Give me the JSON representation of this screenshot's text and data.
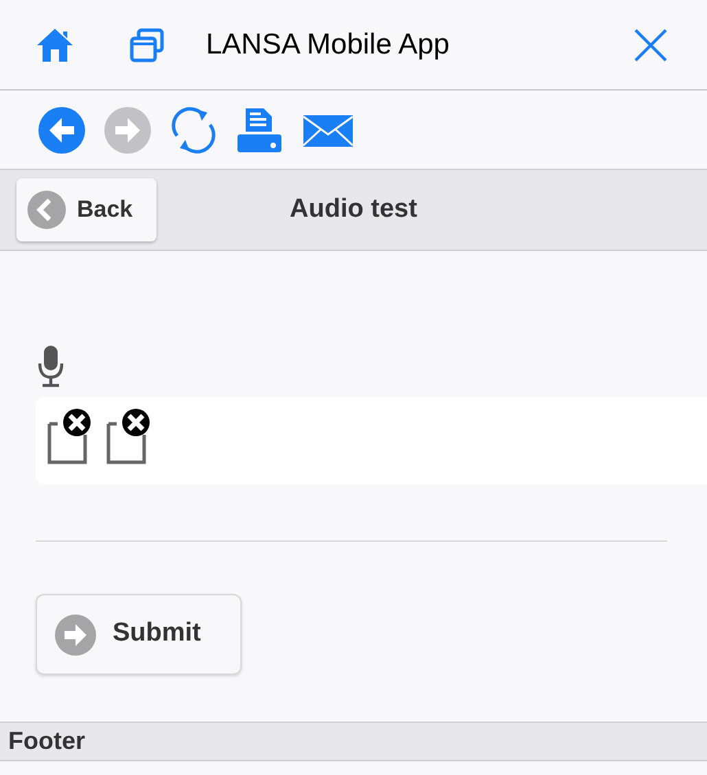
{
  "app_bar": {
    "title": "LANSA Mobile App"
  },
  "toolbar": [
    {
      "kind": "back",
      "disabled": false
    },
    {
      "kind": "forward",
      "disabled": true
    },
    {
      "kind": "refresh",
      "disabled": false
    },
    {
      "kind": "print",
      "disabled": false
    },
    {
      "kind": "mail",
      "disabled": false
    }
  ],
  "page_header": {
    "back_button": "Back",
    "title": "Audio test"
  },
  "audio_players": [
    {
      "kind": "broken-media"
    },
    {
      "kind": "broken-media"
    }
  ],
  "submit_button": "Submit",
  "footer": "Footer"
}
